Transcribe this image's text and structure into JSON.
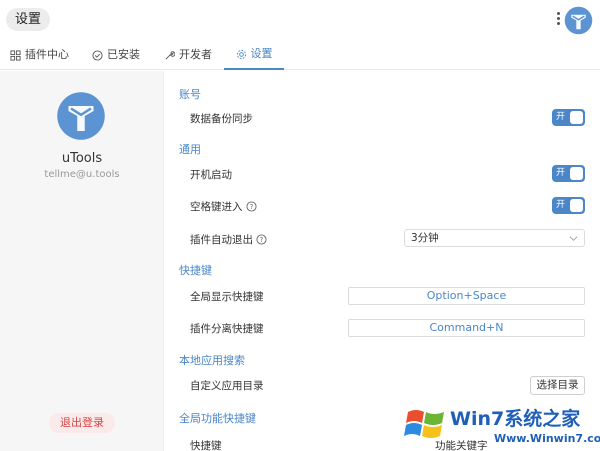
{
  "header": {
    "search_text": "设置",
    "more_icon": "more-vertical-icon",
    "logo_icon": "utools-logo-icon"
  },
  "tabs": [
    {
      "label": "插件中心",
      "icon": "grid-icon"
    },
    {
      "label": "已安装",
      "icon": "check-circle-icon"
    },
    {
      "label": "开发者",
      "icon": "wrench-icon"
    },
    {
      "label": "设置",
      "icon": "gear-icon",
      "active": true
    }
  ],
  "sidebar": {
    "app_name": "uTools",
    "email": "tellme@u.tools",
    "logout_label": "退出登录"
  },
  "sections": {
    "account": {
      "title": "账号",
      "backup_label": "数据备份同步",
      "backup_toggle": "开"
    },
    "general": {
      "title": "通用",
      "startup_label": "开机启动",
      "startup_toggle": "开",
      "space_label": "空格键进入",
      "space_toggle": "开",
      "auto_exit_label": "插件自动退出",
      "auto_exit_value": "3分钟"
    },
    "hotkeys": {
      "title": "快捷键",
      "global_show_label": "全局显示快捷键",
      "global_show_value": "Option+Space",
      "detach_label": "插件分离快捷键",
      "detach_value": "Command+N"
    },
    "local_search": {
      "title": "本地应用搜索",
      "custom_dir_label": "自定义应用目录",
      "choose_dir_label": "选择目录"
    },
    "global_function": {
      "title": "全局功能快捷键",
      "hotkey_col": "快捷键",
      "keyword_col": "功能关键字"
    }
  },
  "watermark": {
    "title": "Win7系统之家",
    "url": "Www.Winwin7.com"
  },
  "colors": {
    "accent": "#4a86c8",
    "logout_text": "#d64545",
    "logout_bg": "#fbeaea",
    "sidebar_bg": "#f6f6f6"
  }
}
